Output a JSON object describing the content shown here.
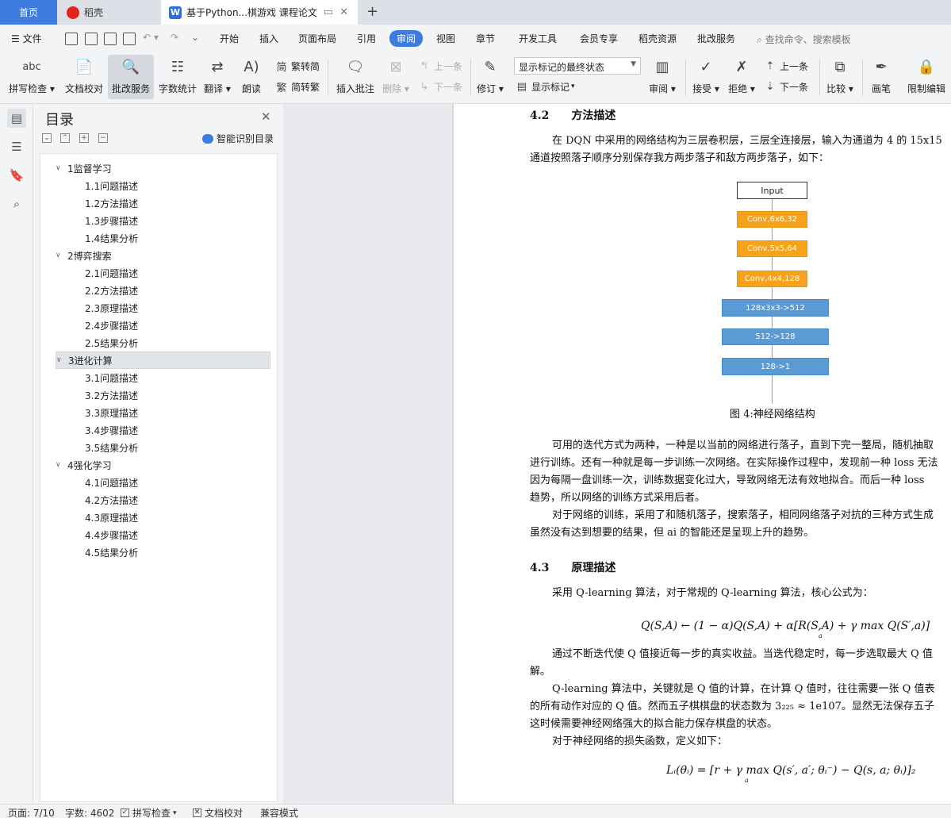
{
  "tabs": {
    "home": "首页",
    "daoke": "稻壳",
    "document": "基于Python...棋游戏 课程论文",
    "new_tab": "+"
  },
  "menu": {
    "file": "文件",
    "items": [
      "开始",
      "插入",
      "页面布局",
      "引用",
      "审阅",
      "视图",
      "章节",
      "开发工具",
      "会员专享",
      "稻壳资源",
      "批改服务"
    ],
    "active": "审阅",
    "search": "查找命令、搜索模板"
  },
  "ribbon": {
    "spell_check": "拼写检查",
    "doc_check": "文档校对",
    "correction": "批改服务",
    "word_count": "字数统计",
    "translate": "翻译",
    "read_aloud": "朗读",
    "trad_to_simp": "繁转简",
    "simp_to_trad": "简转繁",
    "insert_comment": "插入批注",
    "delete": "删除",
    "prev_comment": "上一条",
    "next_comment": "下一条",
    "revise": "修订",
    "markup_select": "显示标记的最终状态",
    "show_markup": "显示标记",
    "review": "审阅",
    "accept": "接受",
    "reject": "拒绝",
    "prev": "上一条",
    "next": "下一条",
    "compare": "比较",
    "pen": "画笔",
    "restrict": "限制编辑",
    "icons": {
      "spell_check": "abc"
    }
  },
  "toc": {
    "title": "目录",
    "smart_button": "智能识别目录",
    "chapters": [
      {
        "label": "1监督学习",
        "items": [
          "1.1问题描述",
          "1.2方法描述",
          "1.3步骤描述",
          "1.4结果分析"
        ]
      },
      {
        "label": "2博弈搜索",
        "items": [
          "2.1问题描述",
          "2.2方法描述",
          "2.3原理描述",
          "2.4步骤描述",
          "2.5结果分析"
        ]
      },
      {
        "label": "3进化计算",
        "items": [
          "3.1问题描述",
          "3.2方法描述",
          "3.3原理描述",
          "3.4步骤描述",
          "3.5结果分析"
        ]
      },
      {
        "label": "4强化学习",
        "items": [
          "4.1问题描述",
          "4.2方法描述",
          "4.3原理描述",
          "4.4步骤描述",
          "4.5结果分析"
        ]
      }
    ],
    "selected": "3进化计算"
  },
  "document": {
    "section_42_title": "4.2  方法描述",
    "p1_line1": "在 DQN 中采用的网络结构为三层卷积层，三层全连接层，输入为通道为  4 的 15x15",
    "p1_line2": "通道按照落子顺序分别保存我方两步落子和敌方两步落子，如下：",
    "flowchart": {
      "nodes": [
        "Input",
        "Conv,6x6,32",
        "Conv,5x5,64",
        "Conv,4x4,128",
        "128x3x3->512",
        "512->128",
        "128->1"
      ]
    },
    "figure_caption": "图  4:神经网络结构",
    "p2_line1": "可用的迭代方式为两种，一种是以当前的网络进行落子，直到下完一整局，随机抽取",
    "p2_line2": "进行训练。还有一种就是每一步训练一次网络。在实际操作过程中，发现前一种  loss 无法",
    "p2_line3": "因为每隔一盘训练一次，训练数据变化过大，导致网络无法有效地拟合。而后一种  loss",
    "p2_line4": "趋势，所以网络的训练方式采用后者。",
    "p3_line1": "对于网络的训练，采用了和随机落子，搜索落子，相同网络落子对抗的三种方式生成",
    "p3_line2": "虽然没有达到想要的结果，但  ai 的智能还是呈现上升的趋势。",
    "section_43_title": "4.3  原理描述",
    "p4": "采用  Q-learning 算法，对于常规的  Q-learning 算法，核心公式为：",
    "formula1": "Q(S,A) ← (1 − α)Q(S,A) + α[R(S,A) + γ max Q(S′,a)]",
    "formula1_sub": "a",
    "p5_line1": "通过不断迭代使  Q 值接近每一步的真实收益。当迭代稳定时，每一步选取最大  Q 值",
    "p5_line2": "解。",
    "p6_line1": "Q-learning 算法中，关键就是  Q 值的计算，在计算  Q 值时，往往需要一张  Q 值表",
    "p6_line2": "的所有动作对应的  Q 值。然而五子棋棋盘的状态数为  3₂₂₅ ≈ 1e107。显然无法保存五子",
    "p6_line3": "这时候需要神经网络强大的拟合能力保存棋盘的状态。",
    "p7": "对于神经网络的损失函数，定义如下：",
    "formula2": "Lᵢ(θᵢ) = [r + γ max Q(s′, a′; θᵢ⁻) − Q(s, a; θᵢ)]₂",
    "formula2_sub": "a"
  },
  "status": {
    "page": "页面: 7/10",
    "words": "字数: 4602",
    "spell_check": "拼写检查",
    "doc_check": "文档校对",
    "compat": "兼容模式"
  }
}
